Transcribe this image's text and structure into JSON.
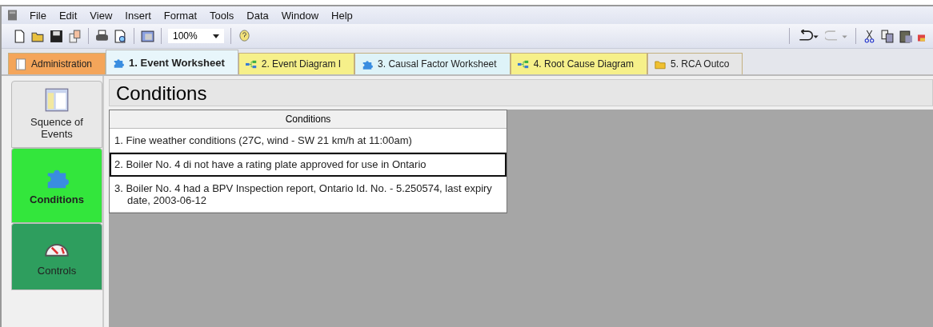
{
  "menu": [
    "File",
    "Edit",
    "View",
    "Insert",
    "Format",
    "Tools",
    "Data",
    "Window",
    "Help"
  ],
  "toolbar": {
    "zoom": "100%",
    "redo_disabled": true
  },
  "tabs": [
    {
      "label": "Administration",
      "kind": "document",
      "color": "#f4a55a",
      "selected": false
    },
    {
      "label": "1. Event Worksheet",
      "kind": "puzzle",
      "color": "#e8f6fb",
      "selected": true
    },
    {
      "label": "2. Event Diagram I",
      "kind": "diagram",
      "color": "#f6f08a",
      "selected": false
    },
    {
      "label": "3. Causal Factor Worksheet",
      "kind": "puzzle",
      "color": "#def3f8",
      "selected": false
    },
    {
      "label": "4. Root Cause Diagram",
      "kind": "diagram",
      "color": "#f6f08a",
      "selected": false
    },
    {
      "label": "5. RCA Outco",
      "kind": "folder",
      "color": "#e6e6e6",
      "selected": false
    }
  ],
  "sidebar": [
    {
      "label": "Squence of Events",
      "kind": "grid",
      "color": "#e8e8e8",
      "selected": false
    },
    {
      "label": "Conditions",
      "kind": "puzzle",
      "color": "#33e63c",
      "selected": true
    },
    {
      "label": "Controls",
      "kind": "gauge",
      "color": "#2e9e5e",
      "selected": false
    }
  ],
  "panel": {
    "title": "Conditions",
    "table": {
      "columns": [
        "Conditions"
      ],
      "rows": [
        {
          "text": "1. Fine weather conditions (27C, wind - SW 21 km/h at 11:00am)",
          "selected": false
        },
        {
          "text": "2. Boiler No. 4 di not have a rating plate approved for use in Ontario",
          "selected": true
        },
        {
          "text": "3. Boiler No. 4 had a BPV Inspection report,  Ontario Id. No. - 5.250574, last expiry date,  2003-06-12",
          "selected": false
        }
      ]
    }
  }
}
